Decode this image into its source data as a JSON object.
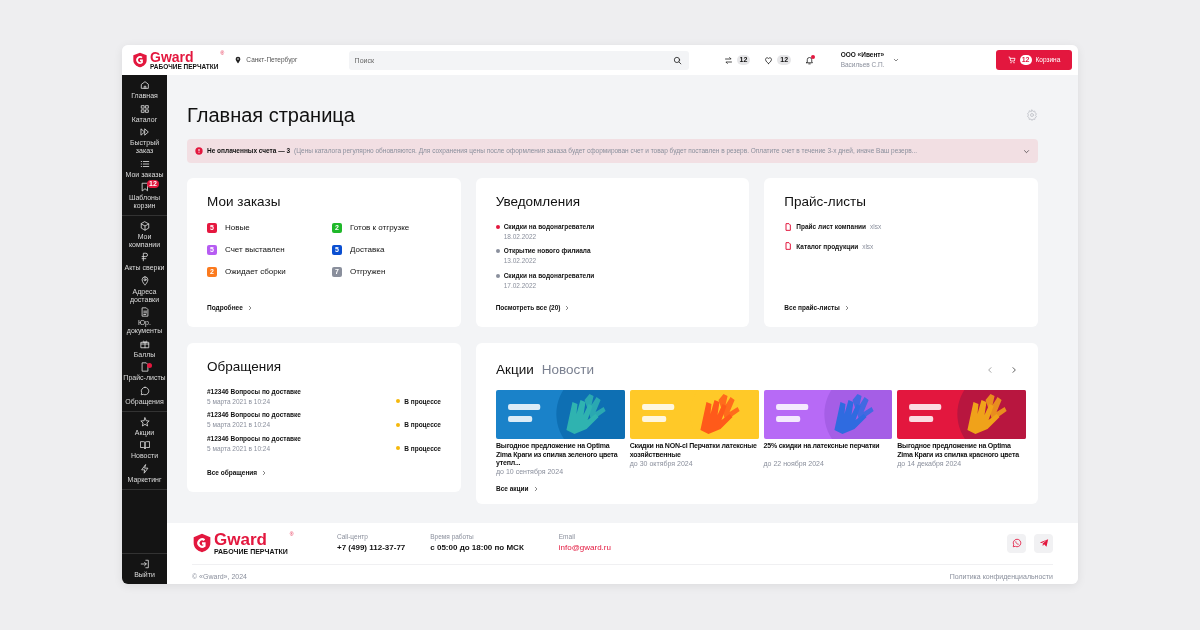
{
  "header": {
    "logo": {
      "name": "Gward",
      "mark": "®",
      "tagline": "РАБОЧИЕ ПЕРЧАТКИ"
    },
    "city": "Санкт-Петербург",
    "search": {
      "placeholder": "Поиск"
    },
    "counters": [
      {
        "count": "12"
      },
      {
        "count": "12"
      }
    ],
    "notifications": {
      "unread": true
    },
    "account": {
      "company": "ООО «Ивент»",
      "user": "Васильев С.П."
    },
    "cart": {
      "count": "12",
      "label": "Корзина"
    }
  },
  "sidebar": {
    "groups": [
      [
        {
          "label": "Главная",
          "selected": false
        },
        {
          "label": "Каталог",
          "selected": false
        },
        {
          "label": "Быстрый заказ",
          "selected": false
        },
        {
          "label": "Мои заказы",
          "selected": false
        },
        {
          "label": "Шаблоны корзин",
          "selected": false,
          "badge": "12"
        }
      ],
      [
        {
          "label": "Мои компании",
          "selected": false
        },
        {
          "label": "Акты сверки",
          "selected": false
        },
        {
          "label": "Адреса доставки",
          "selected": false
        },
        {
          "label": "Юр. документы",
          "selected": false
        },
        {
          "label": "Баллы",
          "selected": false
        },
        {
          "label": "Прайс-листы",
          "selected": false,
          "dot": true
        },
        {
          "label": "Обращения",
          "selected": false
        }
      ],
      [
        {
          "label": "Акции",
          "selected": false
        },
        {
          "label": "Новости",
          "selected": false
        },
        {
          "label": "Маркетинг",
          "selected": false
        }
      ],
      [
        {
          "label": "Выйти",
          "selected": false
        }
      ]
    ]
  },
  "page": {
    "title": "Главная страница"
  },
  "alert": {
    "title": "Не оплаченных счета — 3",
    "text": "(Цены каталога регулярно обновляются. Для сохранения цены после оформления заказа будет сформирован счет и товар будет поставлен в резерв. Оплатите счет в течение 3-х дней, иначе Ваш резерв...",
    "expanded": false
  },
  "orders": {
    "title": "Мои заказы",
    "statuses": [
      {
        "count": "5",
        "label": "Новые",
        "color": "#e5173f"
      },
      {
        "count": "2",
        "label": "Готов к отгрузке",
        "color": "#1fb82a"
      },
      {
        "count": "5",
        "label": "Счет выставлен",
        "color": "#b65cf2"
      },
      {
        "count": "5",
        "label": "Доставка",
        "color": "#0a4fd1"
      },
      {
        "count": "2",
        "label": "Ожидает сборки",
        "color": "#fb7a1e"
      },
      {
        "count": "7",
        "label": "Отгружен",
        "color": "#8a8f9c"
      }
    ],
    "link": "Подробнее"
  },
  "notifications": {
    "title": "Уведомления",
    "items": [
      {
        "text": "Скидки на водонагреватели",
        "date": "18.02.2022",
        "unread": true
      },
      {
        "text": "Открытие нового филиала",
        "date": "13.02.2022",
        "unread": false
      },
      {
        "text": "Скидки на водонагреватели",
        "date": "17.02.2022",
        "unread": false
      }
    ],
    "link": "Посмотреть все (20)"
  },
  "pricelists": {
    "title": "Прайс-листы",
    "items": [
      {
        "name": "Прайс лист компании",
        "ext": "xlsx"
      },
      {
        "name": "Каталог продукции",
        "ext": "xlsx"
      }
    ],
    "link": "Все прайс-листы"
  },
  "tickets": {
    "title": "Обращения",
    "items": [
      {
        "title": "#12346 Вопросы по доставке",
        "date": "5 марта 2021 в 10:24",
        "status": "В процессе",
        "color": "#f5b80b"
      },
      {
        "title": "#12346 Вопросы по доставке",
        "date": "5 марта 2021 в 10:24",
        "status": "В процессе",
        "color": "#f5b80b"
      },
      {
        "title": "#12346 Вопросы по доставке",
        "date": "5 марта 2021 в 10:24",
        "status": "В процессе",
        "color": "#f5b80b"
      }
    ],
    "link": "Все обращения"
  },
  "promos": {
    "tabs": [
      {
        "label": "Акции",
        "selected": true
      },
      {
        "label": "Новости",
        "selected": false
      }
    ],
    "items": [
      {
        "title": "Выгодное предложение на Optima Zima Краги из спилка зеленого цвета утепл...",
        "date": "до 10 сентября 2024"
      },
      {
        "title": "Скидки на NON-cl Перчатки латексные хозяйственные",
        "date": "до 30 октября 2024"
      },
      {
        "title": "25% скидки на латексные перчатки",
        "date": "до 22 ноября 2024"
      },
      {
        "title": "Выгодное предложение на Optima Zima Краги из спилка красного цвета",
        "date": "до 14 декабря 2024"
      }
    ],
    "link": "Все акции"
  },
  "footer": {
    "logo": {
      "name": "Gward",
      "mark": "®",
      "tagline": "РАБОЧИЕ ПЕРЧАТКИ"
    },
    "contacts": [
      {
        "label": "Call-центр",
        "value": "+7 (499) 112-37-77",
        "kind": "text"
      },
      {
        "label": "Время работы",
        "value": "с 05:00 до 18:00 по МСК",
        "kind": "text"
      },
      {
        "label": "Email",
        "value": "info@gward.ru",
        "kind": "link"
      }
    ],
    "copyright": "© «Gward», 2024",
    "policy": "Политика конфиденциальности"
  }
}
